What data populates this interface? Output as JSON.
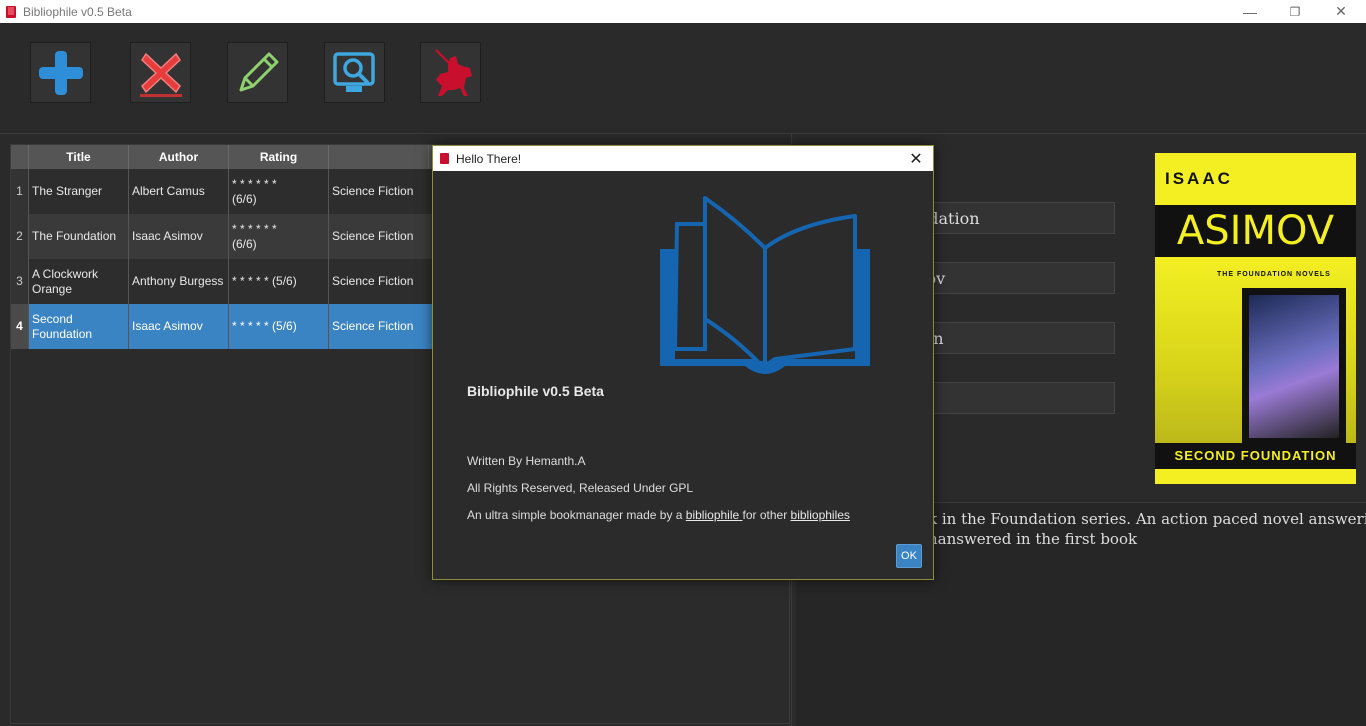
{
  "window": {
    "title": "Bibliophile v0.5 Beta",
    "minimize_glyph": "—",
    "maximize_glyph": "❐",
    "close_glyph": "✕"
  },
  "toolbar": {
    "buttons": [
      {
        "name": "add-book-button",
        "icon": "plus-icon",
        "color": "#2e8fd8"
      },
      {
        "name": "delete-book-button",
        "icon": "red-x-icon",
        "color": "#e63c3c"
      },
      {
        "name": "edit-book-button",
        "icon": "pencil-icon",
        "color": "#8fd16f"
      },
      {
        "name": "search-book-button",
        "icon": "search-monitor-icon",
        "color": "#3fa7e0"
      },
      {
        "name": "about-button",
        "icon": "knight-icon",
        "color": "#c8102e"
      }
    ]
  },
  "table": {
    "columns": [
      "Title",
      "Author",
      "Rating",
      ""
    ],
    "rows": [
      {
        "num": "1",
        "title": "The Stranger",
        "author": "Albert Camus",
        "rating": "* * * * * *\n(6/6)",
        "genre": "Science Fiction"
      },
      {
        "num": "2",
        "title": "The Foundation",
        "author": "Isaac Asimov",
        "rating": "* * * * * *\n(6/6)",
        "genre": "Science Fiction"
      },
      {
        "num": "3",
        "title": "A Clockwork\nOrange",
        "author": "Anthony Burgess",
        "rating": "* * * * * (5/6)",
        "genre": "Science Fiction"
      },
      {
        "num": "4",
        "title": "Second\nFoundation",
        "author": "Isaac Asimov",
        "rating": "* * * * * (5/6)",
        "genre": "Science Fiction"
      }
    ]
  },
  "details": {
    "field1": "oundation",
    "field2": "simov",
    "field3": "iction",
    "field4": "",
    "description_line1": "k in the Foundation series. An action paced novel answering",
    "description_line2": "nanswered in the first book"
  },
  "cover": {
    "author_first": "ISAAC",
    "author_last": "ASIMOV",
    "series": "THE FOUNDATION NOVELS",
    "book_title": "SECOND FOUNDATION"
  },
  "dialog": {
    "title": "Hello There!",
    "close_glyph": "✕",
    "heading": "Bibliophile v0.5 Beta",
    "written_by": "Written By Hemanth.A",
    "rights": "All Rights Reserved, Released Under GPL",
    "desc_prefix": "An ultra simple bookmanager made by a ",
    "desc_link1": "bibliophile ",
    "desc_mid": "for other ",
    "desc_link2": "bibliophiles ",
    "ok_label": "OK",
    "logo_icon": "open-book-icon",
    "logo_color": "#1565b0"
  }
}
